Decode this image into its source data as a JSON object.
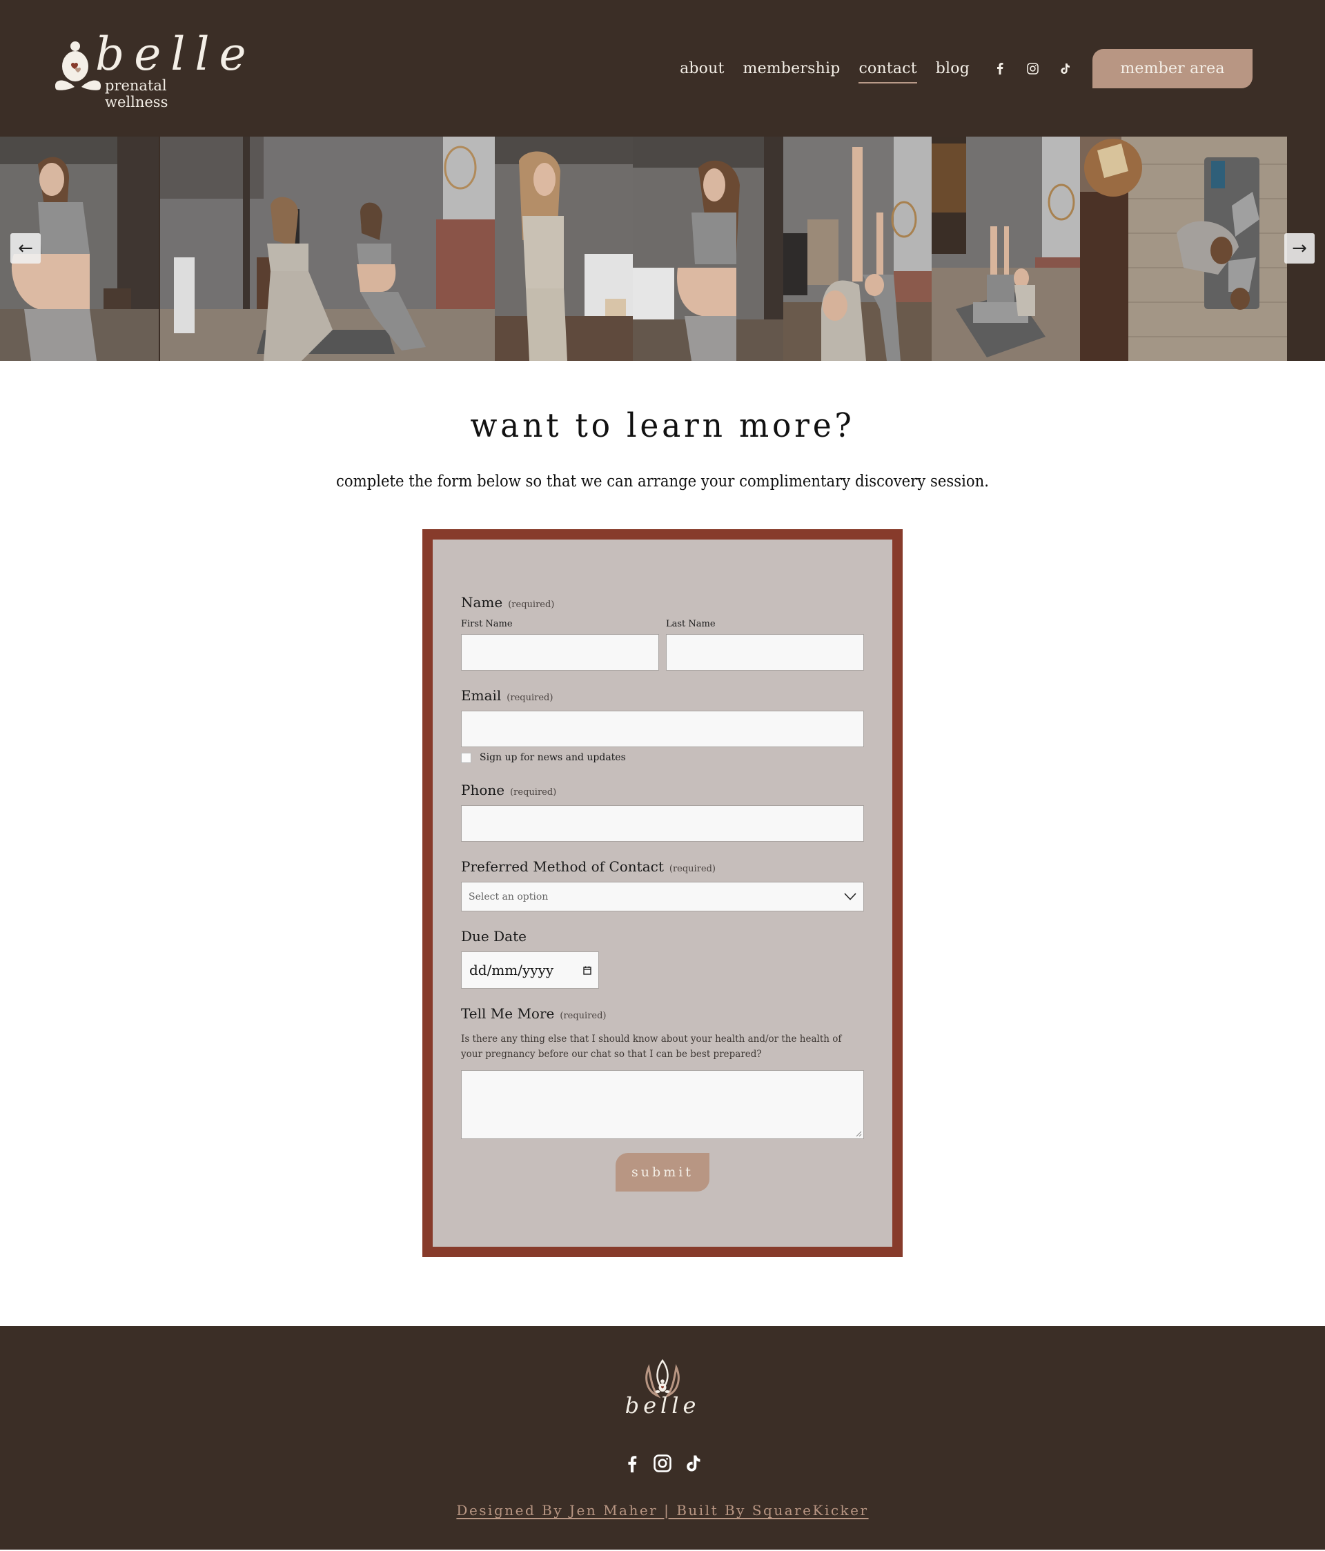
{
  "header": {
    "logo": {
      "wordmark": "belle",
      "tagline": "prenatal wellness"
    },
    "nav": [
      {
        "label": "about",
        "active": false
      },
      {
        "label": "membership",
        "active": false
      },
      {
        "label": "contact",
        "active": true
      },
      {
        "label": "blog",
        "active": false
      }
    ],
    "social": [
      "facebook-icon",
      "instagram-icon",
      "tiktok-icon"
    ],
    "cta_label": "member area"
  },
  "gallery": {
    "prev_label": "←",
    "next_label": "→",
    "slides": [
      {
        "description": "pregnant woman in grey sports top, side profile, hand on belly"
      },
      {
        "description": "two women doing lunge stretches in a loft living room"
      },
      {
        "description": "smiling woman in beige activewear, side profile"
      },
      {
        "description": "pregnant woman in grey sports top, side profile, hand on belly"
      },
      {
        "description": "two women doing side stretches, arms raised"
      },
      {
        "description": "two women doing kneeling stretch on yoga mat by fireplace"
      },
      {
        "description": "overhead view of two women stretching on yoga mat"
      }
    ]
  },
  "intro": {
    "title": "want to learn more?",
    "subtitle": "complete the form below so that we can arrange your complimentary discovery session."
  },
  "form": {
    "required_label": "(required)",
    "name": {
      "label": "Name",
      "first_label": "First Name",
      "first_value": "",
      "last_label": "Last Name",
      "last_value": ""
    },
    "email": {
      "label": "Email",
      "value": "",
      "newsletter_label": "Sign up for news and updates",
      "newsletter_checked": false
    },
    "phone": {
      "label": "Phone",
      "value": ""
    },
    "contact_method": {
      "label": "Preferred Method of Contact",
      "selected": "Select an option"
    },
    "due_date": {
      "label": "Due Date",
      "placeholder": "dd/mm/yyyy"
    },
    "tell_me_more": {
      "label": "Tell Me More",
      "description": "Is there any thing else that I should know about your health and/or the health of your pregnancy before our chat so that I can be best prepared?",
      "value": ""
    },
    "submit_label": "submit"
  },
  "footer": {
    "wordmark": "belle",
    "social": [
      "facebook-icon",
      "instagram-icon",
      "tiktok-icon"
    ],
    "credits": "Designed By Jen Maher | Built By SquareKicker"
  },
  "colors": {
    "header_bg": "#3b2e26",
    "accent": "#b89683",
    "form_border": "#873b2b",
    "form_bg": "#c6bebb",
    "text_light": "#f4efe7"
  }
}
